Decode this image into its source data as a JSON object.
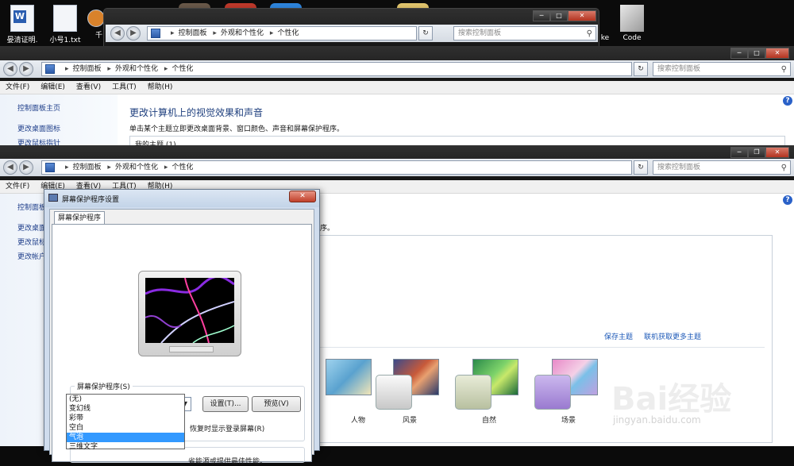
{
  "desktop": {
    "icons": [
      {
        "name": "晏清证明."
      },
      {
        "name": "小号1.txt"
      },
      {
        "name": "千"
      },
      {
        "name": "ke"
      },
      {
        "name": "Code"
      }
    ]
  },
  "windows": [
    {
      "breadcrumb": [
        "控制面板",
        "外观和个性化",
        "个性化"
      ],
      "search_placeholder": "搜索控制面板"
    },
    {
      "breadcrumb": [
        "控制面板",
        "外观和个性化",
        "个性化"
      ],
      "search_placeholder": "搜索控制面板",
      "menu": [
        "文件(F)",
        "编辑(E)",
        "查看(V)",
        "工具(T)",
        "帮助(H)"
      ],
      "left_links": [
        "控制面板主页",
        "更改桌面图标",
        "更改鼠标指针"
      ],
      "heading": "更改计算机上的视觉效果和声音",
      "subtext": "单击某个主题立即更改桌面背景、窗口颜色、声音和屏幕保护程序。",
      "my_themes": "我的主题 (1)"
    },
    {
      "breadcrumb": [
        "控制面板",
        "外观和个性化",
        "个性化"
      ],
      "search_placeholder": "搜索控制面板",
      "menu": [
        "文件(F)",
        "编辑(E)",
        "查看(V)",
        "工具(T)",
        "帮助(H)"
      ],
      "left_links": [
        "控制面板",
        "更改桌面",
        "更改鼠标",
        "更改帐户"
      ],
      "partial_text": "序。",
      "save_theme": "保存主题",
      "get_more_themes": "联机获取更多主题",
      "themes": [
        {
          "label": "人物"
        },
        {
          "label": "风景"
        },
        {
          "label": "自然"
        },
        {
          "label": "场景"
        }
      ]
    }
  ],
  "dialog": {
    "title": "屏幕保护程序设置",
    "tab": "屏幕保护程序",
    "group_label": "屏幕保护程序(S)",
    "selected": "彩带",
    "settings_button": "设置(T)...",
    "preview_button": "预览(V)",
    "resume_text": "恢复时显示登录屏幕(R)",
    "power_text": "省能源或提供最佳性能。",
    "options": [
      "(无)",
      "变幻线",
      "彩带",
      "空白",
      "气泡",
      "三维文字"
    ],
    "highlighted_option": "气泡",
    "close_label": "✕"
  },
  "watermark": {
    "main": "Bai经验",
    "sub": "jingyan.baidu.com"
  }
}
